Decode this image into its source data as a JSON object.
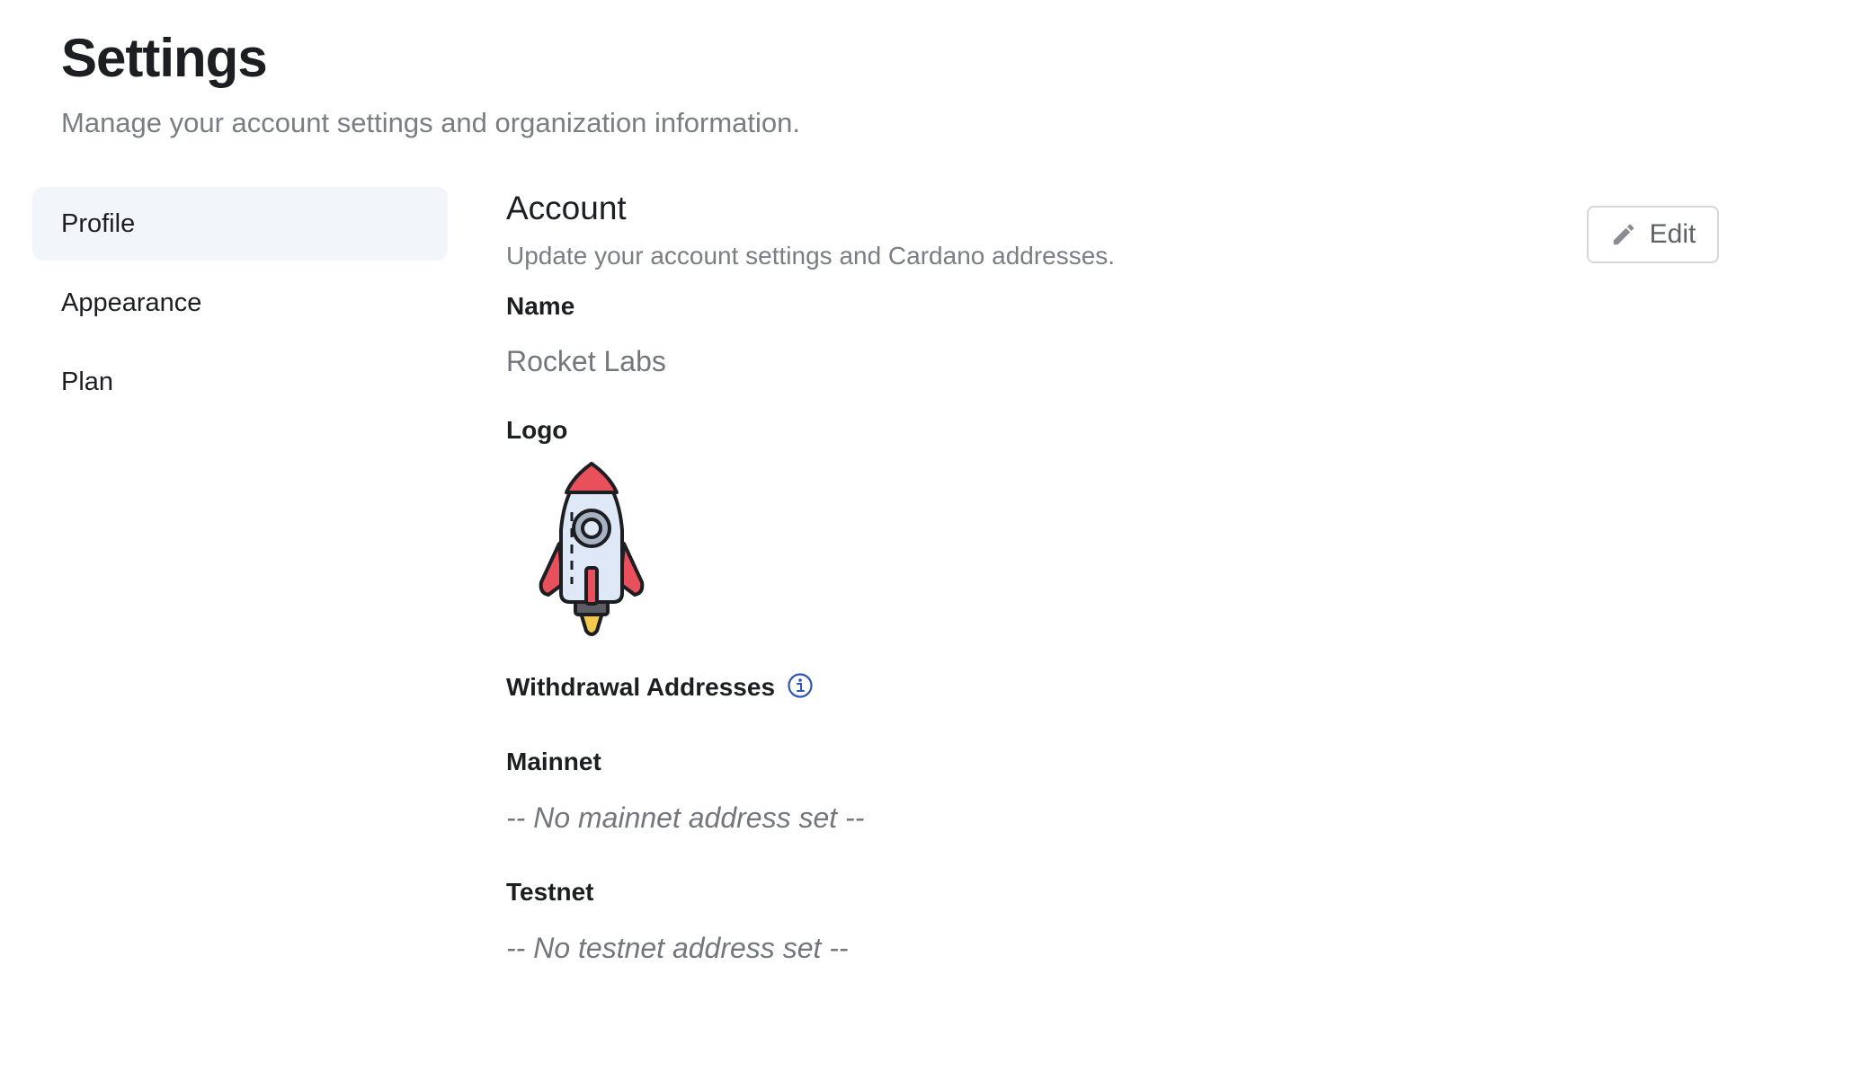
{
  "header": {
    "title": "Settings",
    "subtitle": "Manage your account settings and organization information."
  },
  "sidebar": {
    "items": [
      {
        "label": "Profile",
        "active": true
      },
      {
        "label": "Appearance",
        "active": false
      },
      {
        "label": "Plan",
        "active": false
      }
    ]
  },
  "account": {
    "title": "Account",
    "description": "Update your account settings and Cardano addresses.",
    "edit_label": "Edit",
    "edit_icon": "pencil-icon",
    "name_label": "Name",
    "name_value": "Rocket Labs",
    "logo_label": "Logo",
    "logo_icon": "rocket-icon",
    "withdrawal_label": "Withdrawal Addresses",
    "withdrawal_info_icon": "info-icon",
    "mainnet_label": "Mainnet",
    "mainnet_value": "-- No mainnet address set --",
    "testnet_label": "Testnet",
    "testnet_value": "-- No testnet address set --"
  },
  "colors": {
    "active_bg": "#f2f5f9",
    "muted_text": "#7a7d82",
    "info_blue": "#2f55b8",
    "rocket_red": "#e8505b",
    "rocket_body": "#dfe8f7",
    "flame": "#f2c94c"
  }
}
